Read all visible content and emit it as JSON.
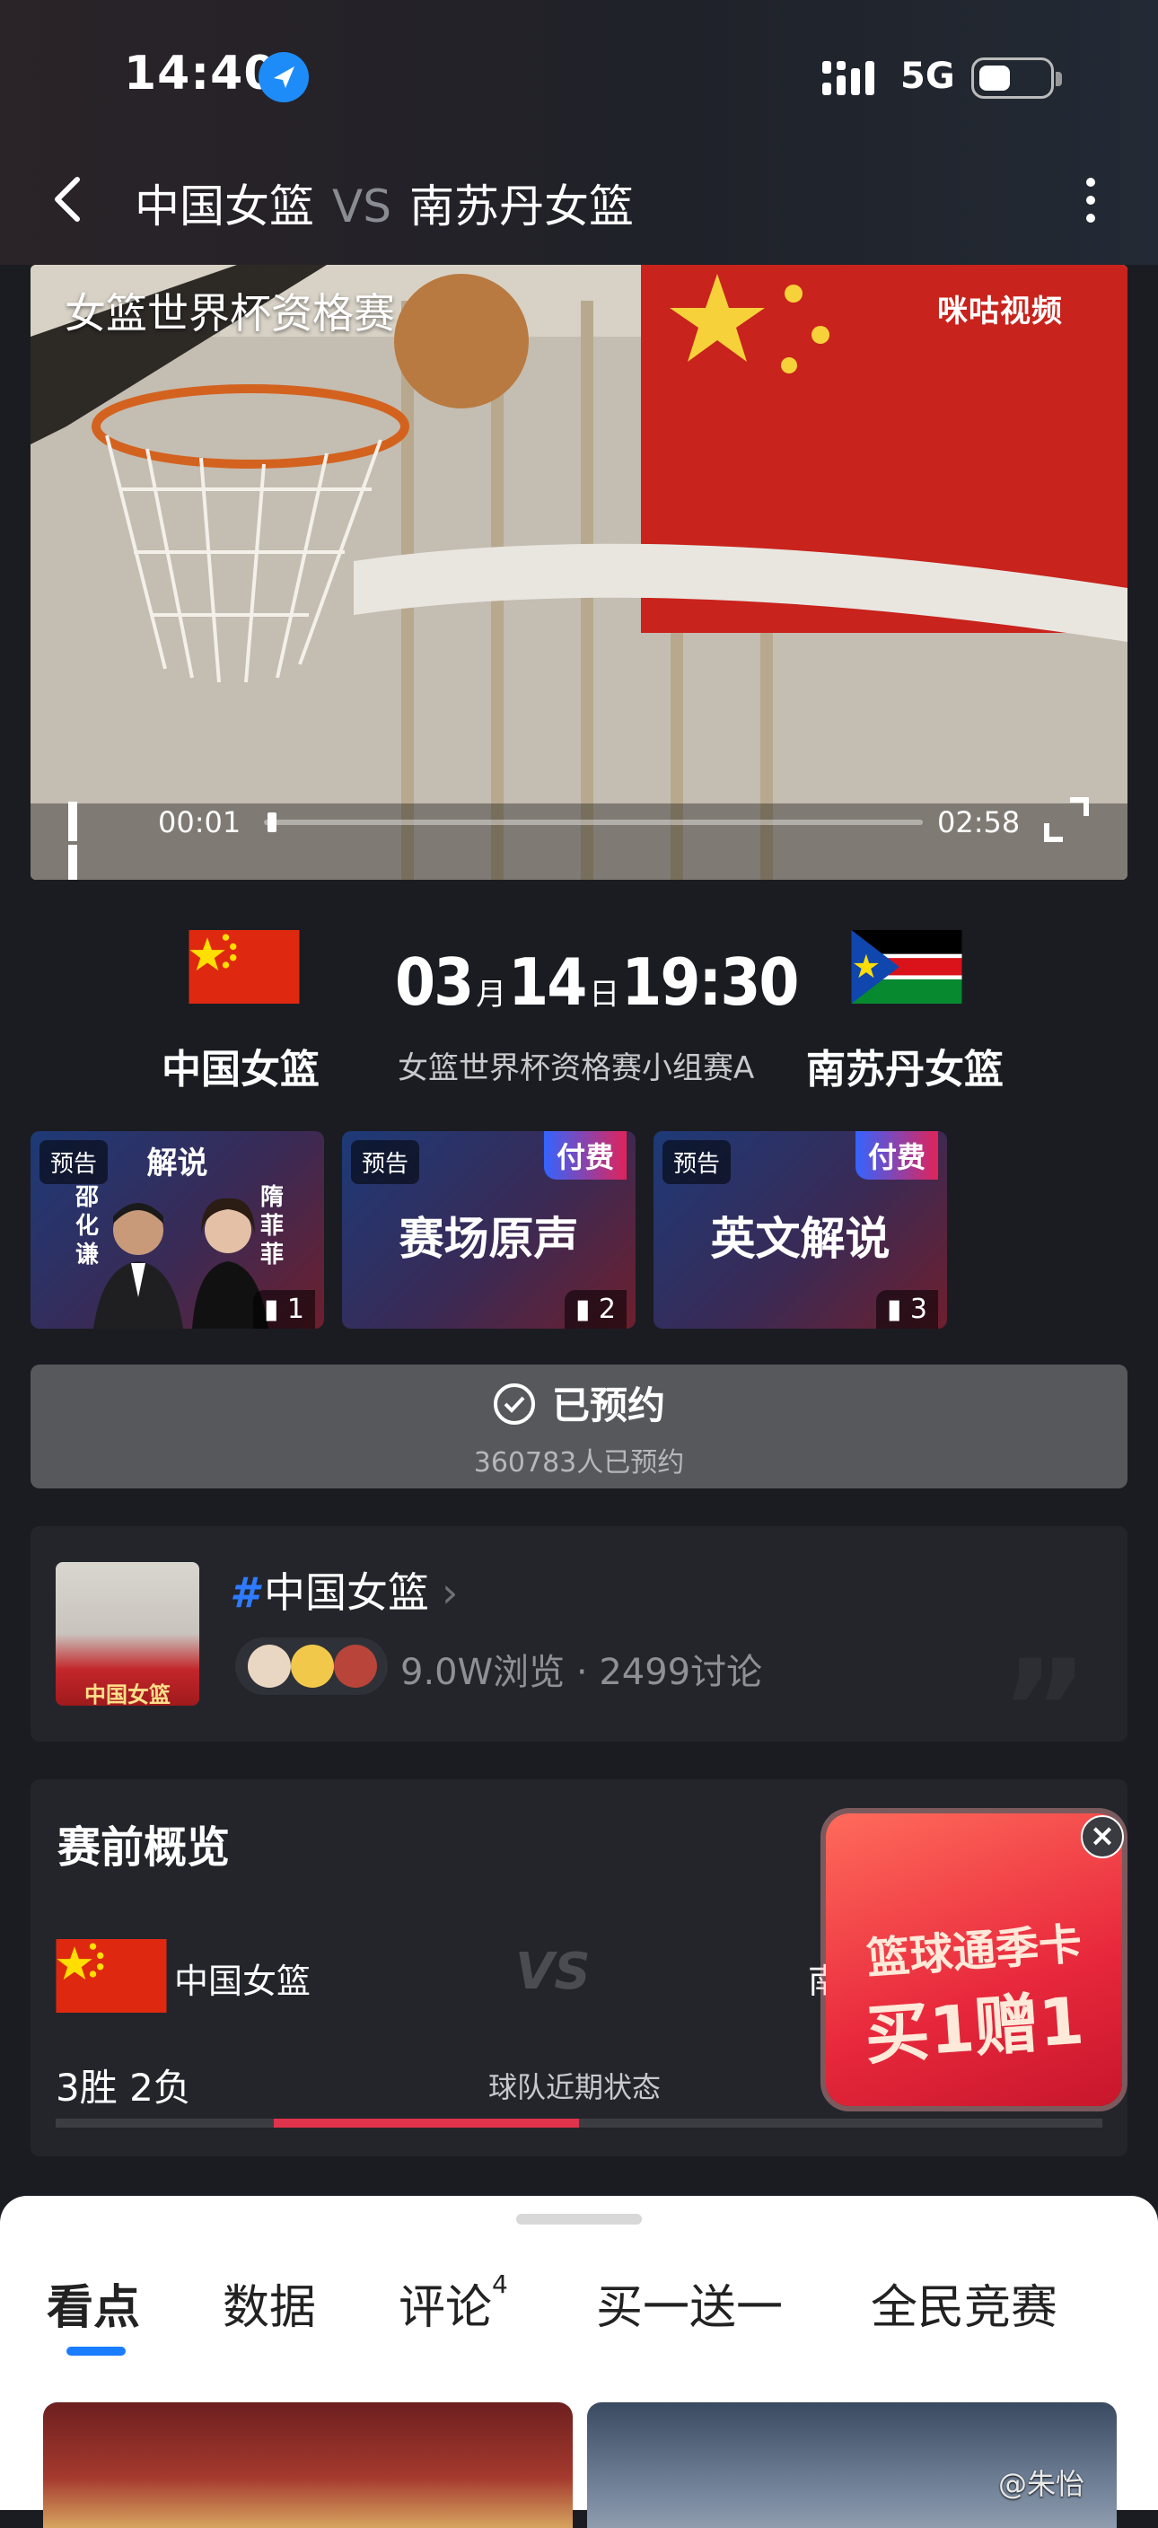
{
  "status": {
    "time": "14:40",
    "network": "5G"
  },
  "header": {
    "team_home": "中国女篮",
    "vs": "VS",
    "team_away": "南苏丹女篮"
  },
  "video": {
    "title": "女篮世界杯资格赛",
    "logo": "咪咕视频",
    "current": "00:01",
    "duration": "02:58",
    "progress": 0.006
  },
  "match": {
    "month": "03",
    "month_unit": "月",
    "day": "14",
    "day_unit": "日",
    "time": "19:30",
    "stage": "女篮世界杯资格赛小组赛A",
    "home": "中国女篮",
    "away": "南苏丹女篮"
  },
  "cards": [
    {
      "tag": "预告",
      "heading": "解说",
      "left_name": "邵\n化\n谦",
      "right_name": "隋\n菲\n菲",
      "num": "1"
    },
    {
      "tag": "预告",
      "paid": "付费",
      "main": "赛场原声",
      "num": "2"
    },
    {
      "tag": "预告",
      "paid": "付费",
      "main": "英文解说",
      "num": "3"
    }
  ],
  "reserve": {
    "label": "已预约",
    "count": "360783人已预约"
  },
  "topic": {
    "hash": "#",
    "name": "中国女篮",
    "views": "9.0W浏览",
    "dot": "·",
    "discussions": "2499讨论",
    "thumb_text": "中国女篮"
  },
  "overview": {
    "title": "赛前概览",
    "home": "中国女篮",
    "vs": "VS",
    "away": "南",
    "record": "3胜 2负",
    "form_label": "球队近期状态"
  },
  "promo": {
    "line1": "篮球通季卡",
    "line2": "买1赠1"
  },
  "tabs": [
    {
      "label": "看点"
    },
    {
      "label": "数据"
    },
    {
      "label": "评论",
      "badge": "4"
    },
    {
      "label": "买一送一"
    },
    {
      "label": "全民竞赛"
    }
  ],
  "watermark": "@朱怡"
}
